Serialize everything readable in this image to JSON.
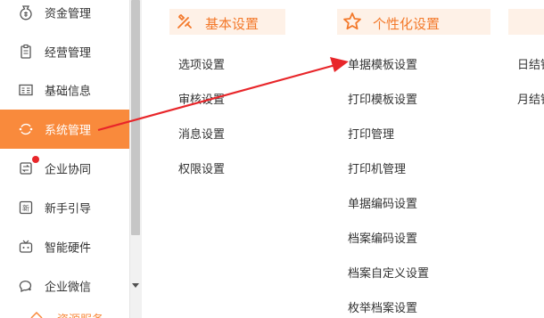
{
  "sidebar": {
    "items": [
      {
        "label": "资金管理",
        "icon": "money-bag-icon"
      },
      {
        "label": "经营管理",
        "icon": "clipboard-icon"
      },
      {
        "label": "基础信息",
        "icon": "info-card-icon"
      },
      {
        "label": "系统管理",
        "icon": "system-refresh-icon",
        "active": true
      },
      {
        "label": "企业协同",
        "icon": "collaboration-icon",
        "badge": "red-dot"
      },
      {
        "label": "新手引导",
        "icon": "new-tag-icon"
      },
      {
        "label": "智能硬件",
        "icon": "tv-robot-icon"
      },
      {
        "label": "企业微信",
        "icon": "wechat-bubble-icon"
      }
    ],
    "partial_item": {
      "label": "资源服务"
    }
  },
  "sections": [
    {
      "title": "基本设置",
      "icon": "tools-icon",
      "links": [
        "选项设置",
        "审核设置",
        "消息设置",
        "权限设置"
      ]
    },
    {
      "title": "个性化设置",
      "icon": "star-icon",
      "links": [
        "单据模板设置",
        "打印模板设置",
        "打印管理",
        "打印机管理",
        "单据编码设置",
        "档案编码设置",
        "档案自定义设置",
        "枚举档案设置"
      ]
    },
    {
      "title": "",
      "icon": "",
      "links": [
        "日结销",
        "月结销"
      ]
    }
  ],
  "colors": {
    "accent": "#f98a3c",
    "header_bg": "#fef1e7",
    "header_text": "#f3792b",
    "annotation_arrow": "#e8262a",
    "badge": "#e8262a"
  }
}
